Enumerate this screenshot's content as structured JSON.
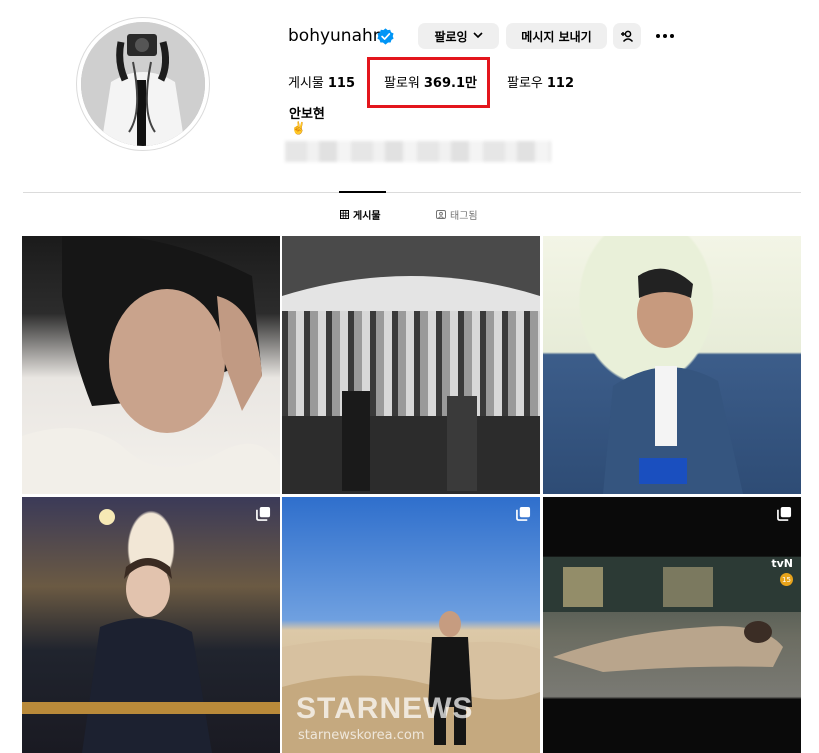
{
  "profile": {
    "username": "bohyunahn",
    "verified": true,
    "full_name": "안보현",
    "bio_emoji": "✌️"
  },
  "actions": {
    "follow_label": "팔로잉",
    "message_label": "메시지 보내기"
  },
  "stats": {
    "posts_label": "게시물",
    "posts_count": "115",
    "followers_label": "팔로워",
    "followers_count": "369.1만",
    "following_label": "팔로우",
    "following_count": "112"
  },
  "tabs": [
    {
      "label": "게시물",
      "active": true
    },
    {
      "label": "태그됨",
      "active": false
    }
  ],
  "watermark": {
    "brand": "STARNEWS",
    "url": "starnewskorea.com"
  },
  "posts": [
    {
      "multi": false
    },
    {
      "multi": false
    },
    {
      "multi": false
    },
    {
      "multi": true
    },
    {
      "multi": true
    },
    {
      "multi": true,
      "broadcaster": "tvN",
      "age_rating": "15"
    }
  ],
  "colors": {
    "verified_badge": "#0095f6",
    "highlight_box": "#e3161c",
    "button_bg": "#efefef"
  }
}
